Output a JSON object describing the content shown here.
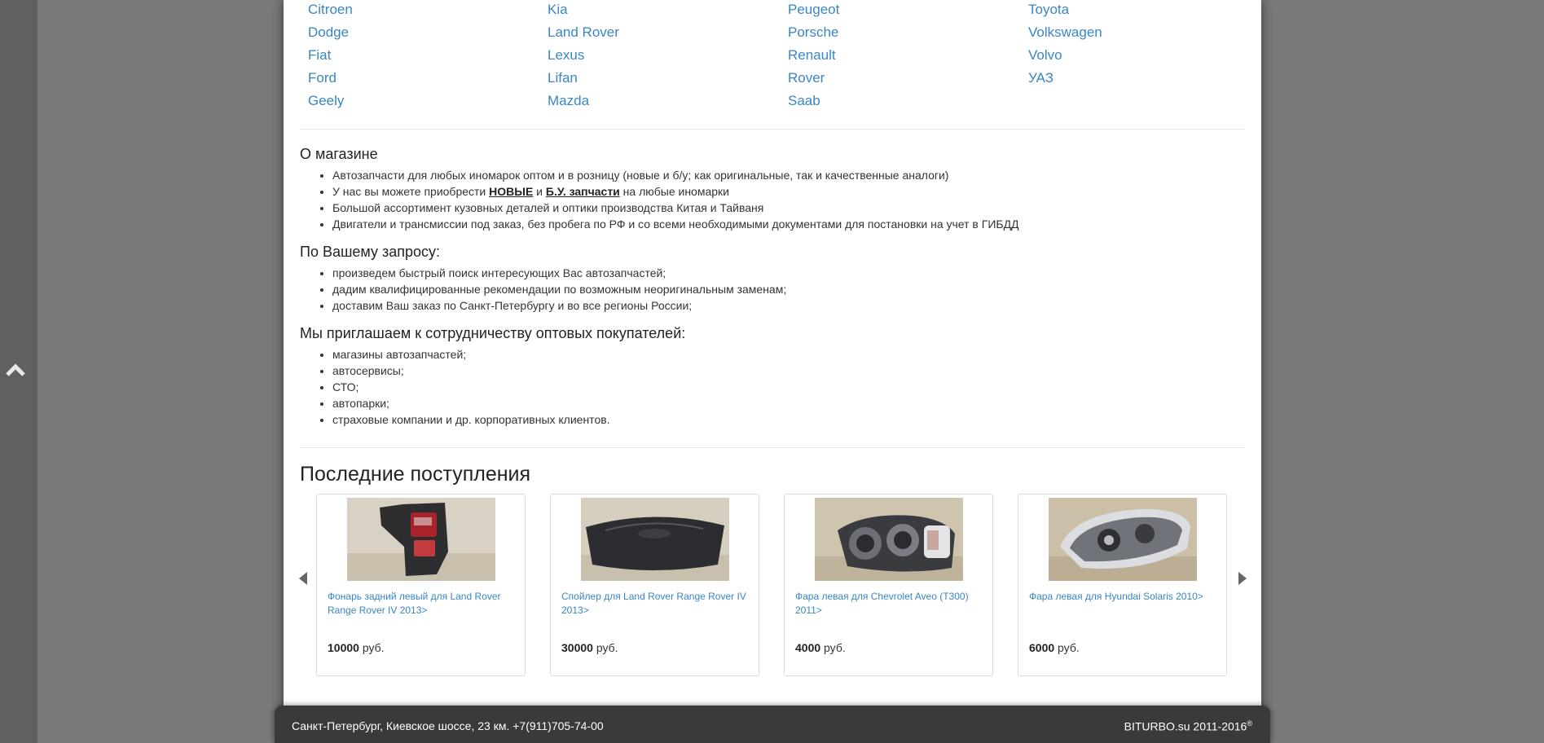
{
  "brands": {
    "col1": [
      "Citroen",
      "Dodge",
      "Fiat",
      "Ford",
      "Geely"
    ],
    "col2": [
      "Kia",
      "Land Rover",
      "Lexus",
      "Lifan",
      "Mazda"
    ],
    "col3": [
      "Peugeot",
      "Porsche",
      "Renault",
      "Rover",
      "Saab"
    ],
    "col4": [
      "Toyota",
      "Volkswagen",
      "Volvo",
      "УАЗ"
    ]
  },
  "about": {
    "title": "О магазине",
    "item1": "Автозапчасти для любых иномарок оптом и в розницу (новые и б/у; как оригинальные, так и качественные аналоги)",
    "item2_pre": "У нас вы можете приобрести ",
    "item2_link1": "НОВЫЕ",
    "item2_mid": " и ",
    "item2_link2": "Б.У. запчасти",
    "item2_post": " на любые иномарки",
    "item3": "Большой ассортимент кузовных деталей и оптики производства Китая и Тайваня",
    "item4": "Двигатели и трансмиссии под заказ, без пробега по РФ и со всеми необходимыми документами для постановки на учет в ГИБДД"
  },
  "request": {
    "title": "По Вашему запросу:",
    "items": [
      "произведем быстрый поиск интересующих Вас автозапчастей;",
      "дадим квалифицированные рекомендации по возможным неоригинальным заменам;",
      "доставим Ваш заказ по Санкт-Петербургу и во все регионы России;"
    ]
  },
  "wholesale": {
    "title": "Мы приглашаем к сотрудничеству оптовых покупателей:",
    "items": [
      "магазины автозапчастей;",
      "автосервисы;",
      "СТО;",
      "автопарки;",
      "страховые компании и др. корпоративных клиентов."
    ]
  },
  "latest": {
    "title": "Последние поступления",
    "products": [
      {
        "name": "Фонарь задний левый для Land Rover Range Rover IV 2013>",
        "price": "10000",
        "currency": " руб."
      },
      {
        "name": "Спойлер для Land Rover Range Rover IV 2013>",
        "price": "30000",
        "currency": " руб."
      },
      {
        "name": "Фара левая для Chevrolet Aveo (T300) 2011>",
        "price": "4000",
        "currency": " руб."
      },
      {
        "name": "Фара левая для Hyundai Solaris 2010>",
        "price": "6000",
        "currency": " руб."
      }
    ]
  },
  "footer": {
    "address": "Санкт-Петербург, Киевское шоссе, 23 км. +7(911)705-74-00",
    "copyright": "BITURBO.su 2011-2016",
    "registered": "®"
  },
  "icons": {
    "scroll_up": "chevron-up-icon",
    "prev": "carousel-prev-icon",
    "next": "carousel-next-icon"
  }
}
